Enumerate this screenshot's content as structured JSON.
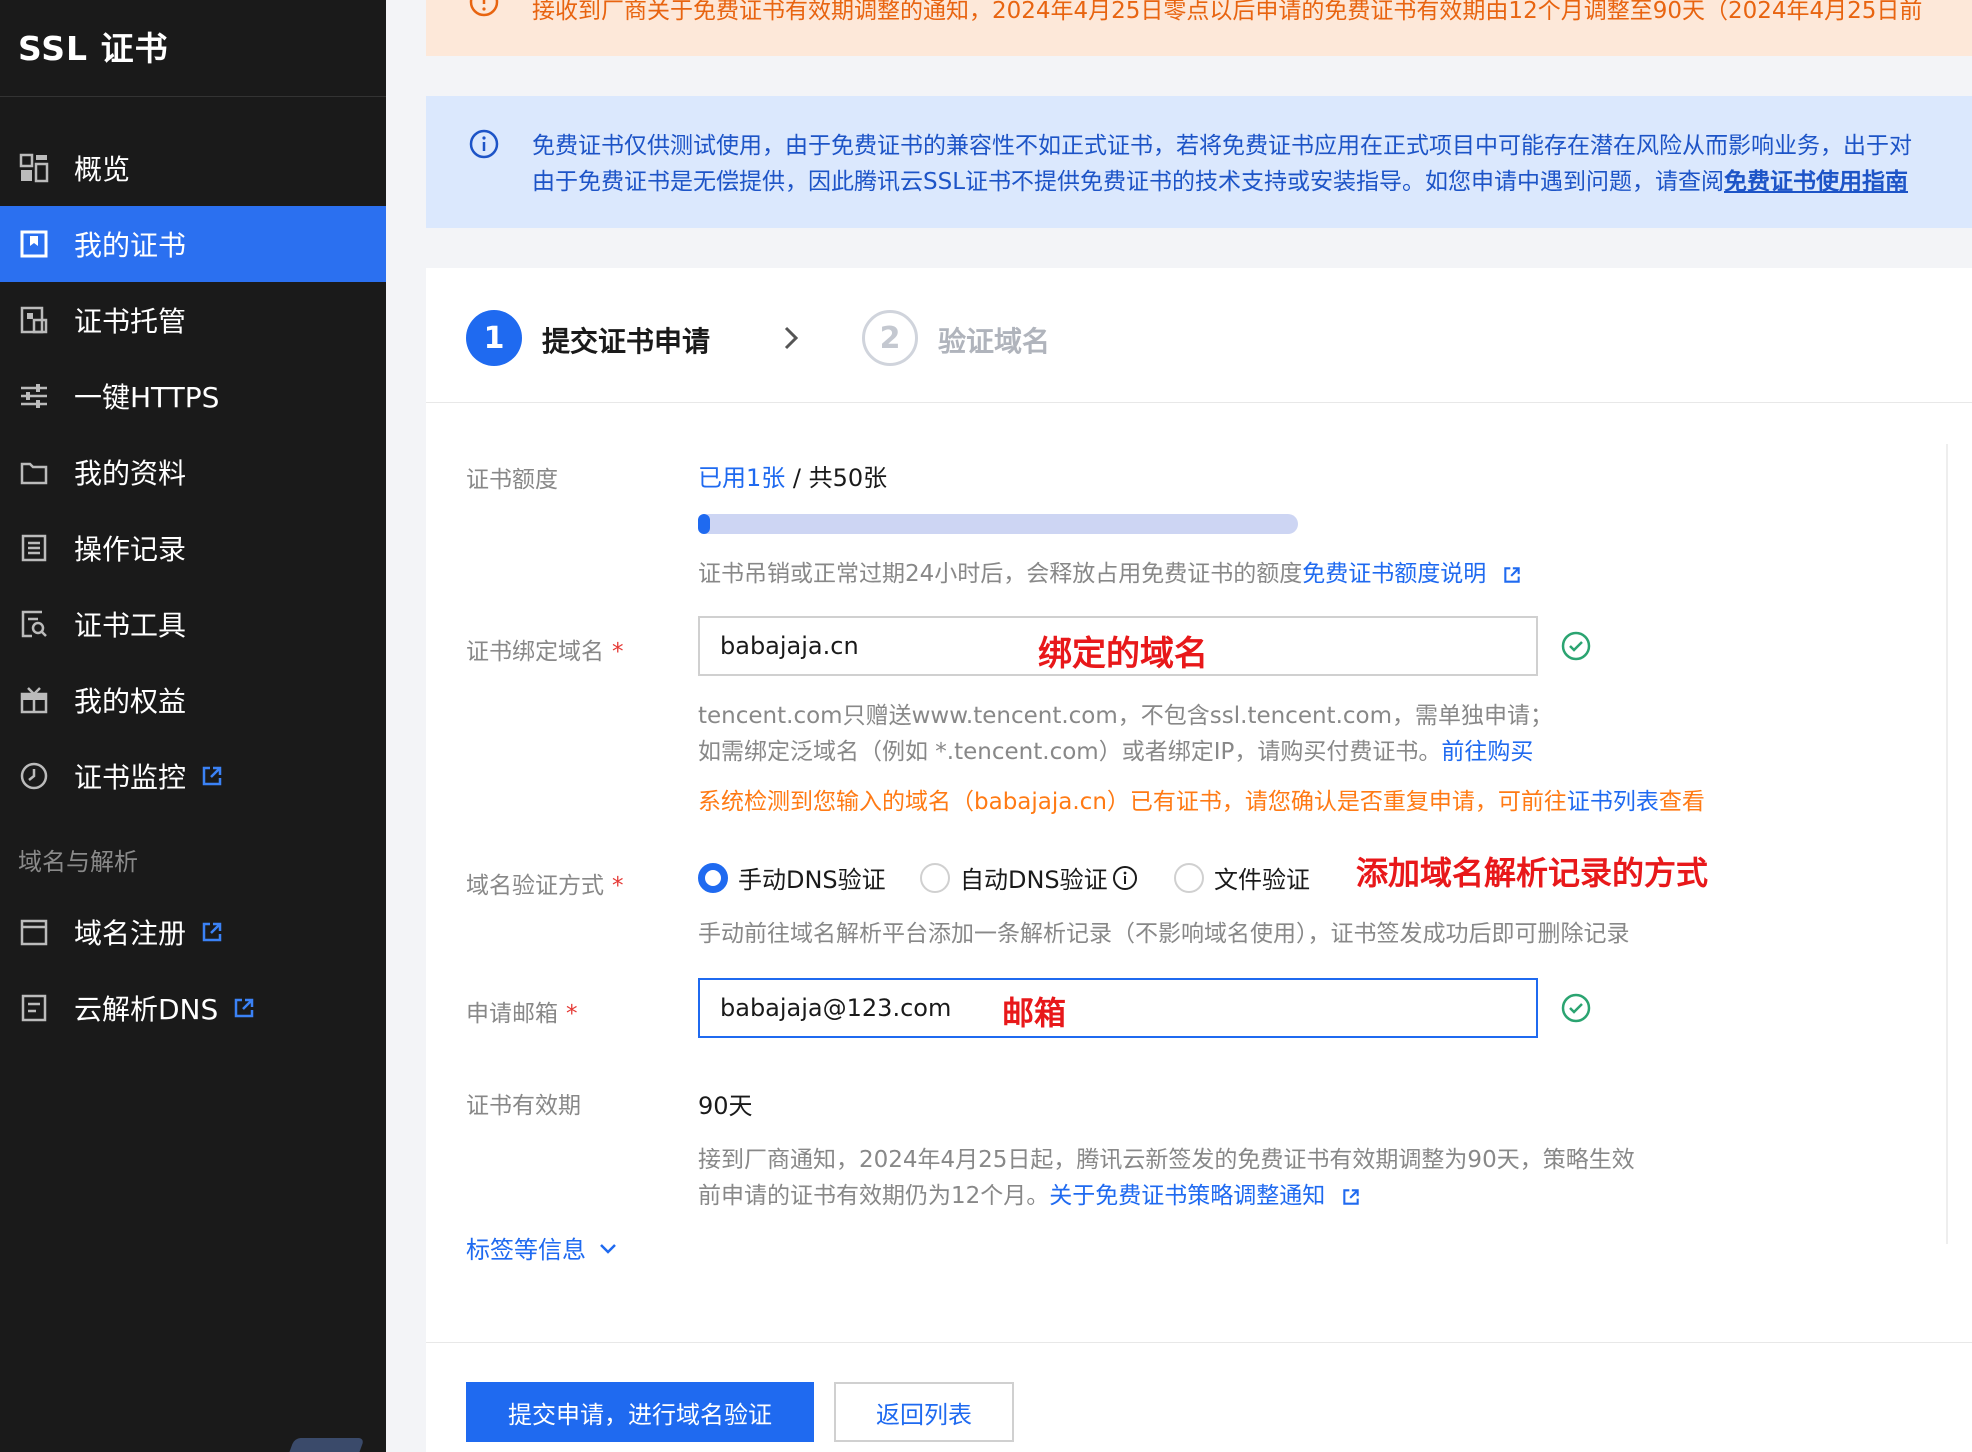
{
  "sidebar": {
    "title": "SSL 证书",
    "items": [
      {
        "label": "概览",
        "icon": "dashboard-icon"
      },
      {
        "label": "我的证书",
        "icon": "certificate-icon",
        "active": true
      },
      {
        "label": "证书托管",
        "icon": "hosting-icon"
      },
      {
        "label": "一键HTTPS",
        "icon": "sliders-icon"
      },
      {
        "label": "我的资料",
        "icon": "folder-icon"
      },
      {
        "label": "操作记录",
        "icon": "log-icon"
      },
      {
        "label": "证书工具",
        "icon": "tool-icon"
      },
      {
        "label": "我的权益",
        "icon": "gift-icon"
      },
      {
        "label": "证书监控",
        "icon": "monitor-icon",
        "external": true
      }
    ],
    "section_label": "域名与解析",
    "section_items": [
      {
        "label": "域名注册",
        "icon": "calendar-icon",
        "external": true
      },
      {
        "label": "云解析DNS",
        "icon": "dns-icon",
        "external": true
      }
    ]
  },
  "notices": {
    "warning": "接收到厂商关于免费证书有效期调整的通知，2024年4月25日零点以后申请的免费证书有效期由12个月调整至90天（2024年4月25日前",
    "info_line1": "免费证书仅供测试使用，由于免费证书的兼容性不如正式证书，若将免费证书应用在正式项目中可能存在潜在风险从而影响业务，出于对",
    "info_line2_prefix": "由于免费证书是无偿提供，因此腾讯云SSL证书不提供免费证书的技术支持或安装指导。如您申请中遇到问题，请查阅",
    "info_line2_link": "免费证书使用指南"
  },
  "steps": {
    "step1_num": "1",
    "step1_label": "提交证书申请",
    "step2_num": "2",
    "step2_label": "验证域名"
  },
  "form": {
    "quota": {
      "label": "证书额度",
      "used": "已用1张",
      "sep": " / ",
      "total": "共50张",
      "progress_fraction": 0.02,
      "hint_prefix": "证书吊销或正常过期24小时后，会释放占用免费证书的额度",
      "hint_link": "免费证书额度说明"
    },
    "domain": {
      "label": "证书绑定域名",
      "required": "*",
      "value": "babajaja.cn",
      "hint1": "tencent.com只赠送www.tencent.com，不包含ssl.tencent.com，需单独申请；",
      "hint2_prefix": "如需绑定泛域名（例如 *.tencent.com）或者绑定IP，请购买付费证书。",
      "hint2_link": "前往购买",
      "warn_prefix": "系统检测到您输入的域名（babajaja.cn）已有证书，请您确认是否重复申请，可前往",
      "warn_link": "证书列表",
      "warn_suffix": "查看"
    },
    "verify": {
      "label": "域名验证方式",
      "required": "*",
      "options": [
        "手动DNS验证",
        "自动DNS验证",
        "文件验证"
      ],
      "selected": "手动DNS验证",
      "hint": "手动前往域名解析平台添加一条解析记录（不影响域名使用），证书签发成功后即可删除记录"
    },
    "email": {
      "label": "申请邮箱",
      "required": "*",
      "value": "babajaja@123.com"
    },
    "validity": {
      "label": "证书有效期",
      "value": "90天",
      "hint1": "接到厂商通知，2024年4月25日起，腾讯云新签发的免费证书有效期调整为90天，策略生效",
      "hint2_prefix": "前申请的证书有效期仍为12个月。",
      "hint2_link": "关于免费证书策略调整通知"
    },
    "tags_link": "标签等信息"
  },
  "annotations": {
    "domain": "绑定的域名",
    "verify": "添加域名解析记录的方式",
    "email": "邮箱"
  },
  "actions": {
    "submit": "提交申请，进行域名验证",
    "back": "返回列表"
  },
  "colors": {
    "primary": "#1f6af0",
    "sidebar_bg": "#1a1a1a",
    "warning": "#e86410",
    "annotation": "#e8181a",
    "success": "#2ba471"
  }
}
